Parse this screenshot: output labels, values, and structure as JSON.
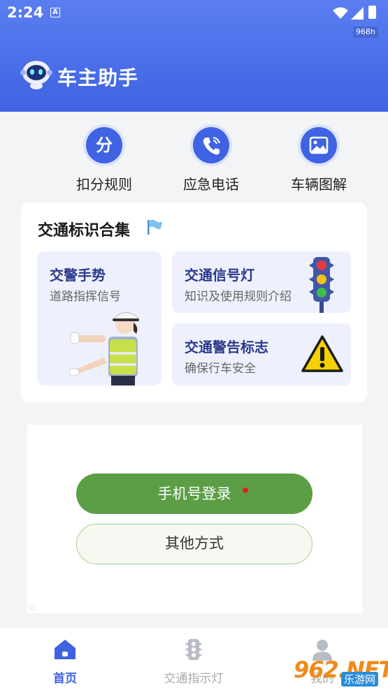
{
  "status_bar": {
    "time": "2:24",
    "net_speed": "968h"
  },
  "app": {
    "title": "车主助手"
  },
  "quick_actions": [
    {
      "label": "扣分规则",
      "icon": "deduction-icon",
      "glyph": "分"
    },
    {
      "label": "应急电话",
      "icon": "phone-icon"
    },
    {
      "label": "车辆图解",
      "icon": "image-icon"
    }
  ],
  "traffic_signs": {
    "title": "交通标识合集",
    "tiles": [
      {
        "title": "交警手势",
        "subtitle": "道路指挥信号",
        "icon": "police-officer-illustration"
      },
      {
        "title": "交通信号灯",
        "subtitle": "知识及使用规则介绍",
        "icon": "traffic-light-icon"
      },
      {
        "title": "交通警告标志",
        "subtitle": "确保行车安全",
        "icon": "warning-sign-icon"
      }
    ]
  },
  "login": {
    "primary_label": "手机号登录",
    "secondary_label": "其他方式"
  },
  "bottom_nav": [
    {
      "label": "首页",
      "icon": "home-icon",
      "active": true
    },
    {
      "label": "交通指示灯",
      "icon": "traffic-light-icon",
      "active": false
    },
    {
      "label": "我的",
      "icon": "profile-icon",
      "active": false
    }
  ],
  "watermark": {
    "text": "962.NET",
    "sub": "乐游网"
  },
  "colors": {
    "primary": "#3f63e3",
    "green": "#5b9e46",
    "tile_bg": "#eef1fd"
  }
}
